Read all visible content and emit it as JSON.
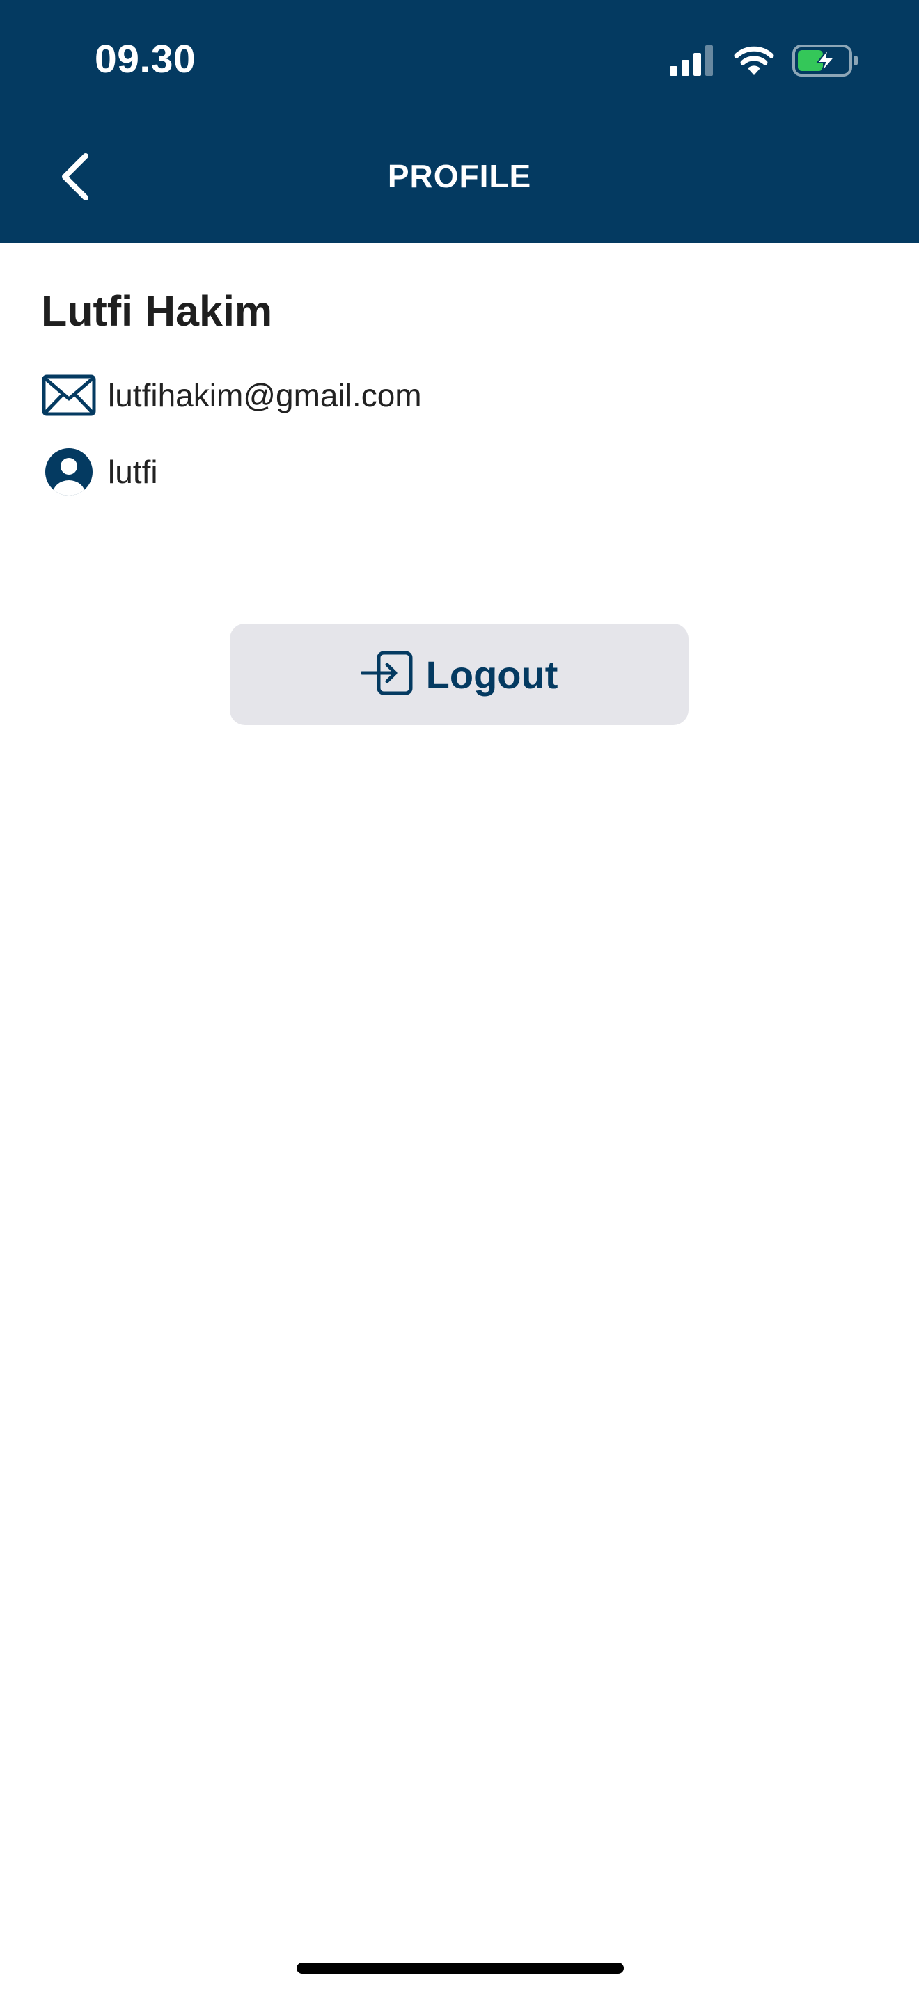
{
  "status_bar": {
    "time": "09.30",
    "signal_icon": "cellular-signal-icon",
    "wifi_icon": "wifi-icon",
    "battery_icon": "battery-charging-icon"
  },
  "header": {
    "title": "PROFILE",
    "back_icon": "chevron-left-icon",
    "background_color": "#043a61"
  },
  "profile": {
    "name": "Lutfi Hakim",
    "email": "lutfihakim@gmail.com",
    "email_icon": "envelope-icon",
    "username": "lutfi",
    "username_icon": "user-circle-icon"
  },
  "actions": {
    "logout_label": "Logout",
    "logout_icon": "logout-icon",
    "accent_color": "#043a61",
    "button_background": "#e5e5ea"
  }
}
